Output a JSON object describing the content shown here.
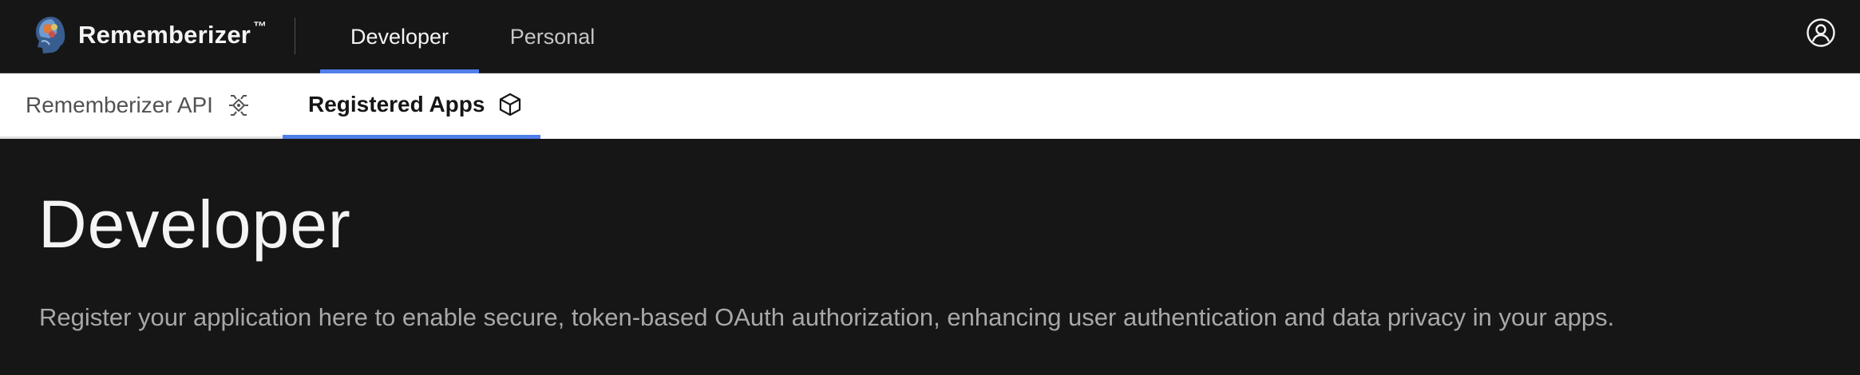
{
  "header": {
    "brand_name": "Rememberizer",
    "brand_tm": "™",
    "nav": [
      {
        "label": "Developer",
        "active": true
      },
      {
        "label": "Personal",
        "active": false
      }
    ],
    "user_icon": "user-avatar-icon"
  },
  "tabs": [
    {
      "label": "Rememberizer API",
      "icon": "api-icon",
      "active": false
    },
    {
      "label": "Registered Apps",
      "icon": "cube-icon",
      "active": true
    }
  ],
  "main": {
    "title": "Developer",
    "description": "Register your application here to enable secure, token-based OAuth authorization, enhancing user authentication and data privacy in your apps."
  },
  "colors": {
    "background": "#161616",
    "accent": "#4f7fea",
    "tabbar": "#ffffff"
  }
}
